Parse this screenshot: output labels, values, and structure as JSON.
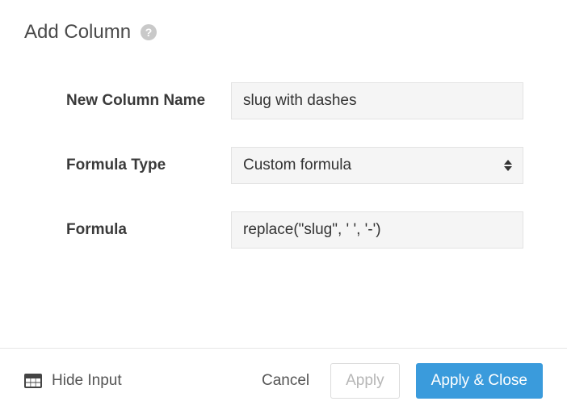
{
  "header": {
    "title": "Add Column"
  },
  "form": {
    "name_label": "New Column Name",
    "name_value": "slug with dashes",
    "type_label": "Formula Type",
    "type_value": "Custom formula",
    "formula_label": "Formula",
    "formula_value": "replace(\"slug\", ' ', '-')"
  },
  "footer": {
    "hide_input": "Hide Input",
    "cancel": "Cancel",
    "apply": "Apply",
    "apply_close": "Apply & Close"
  }
}
